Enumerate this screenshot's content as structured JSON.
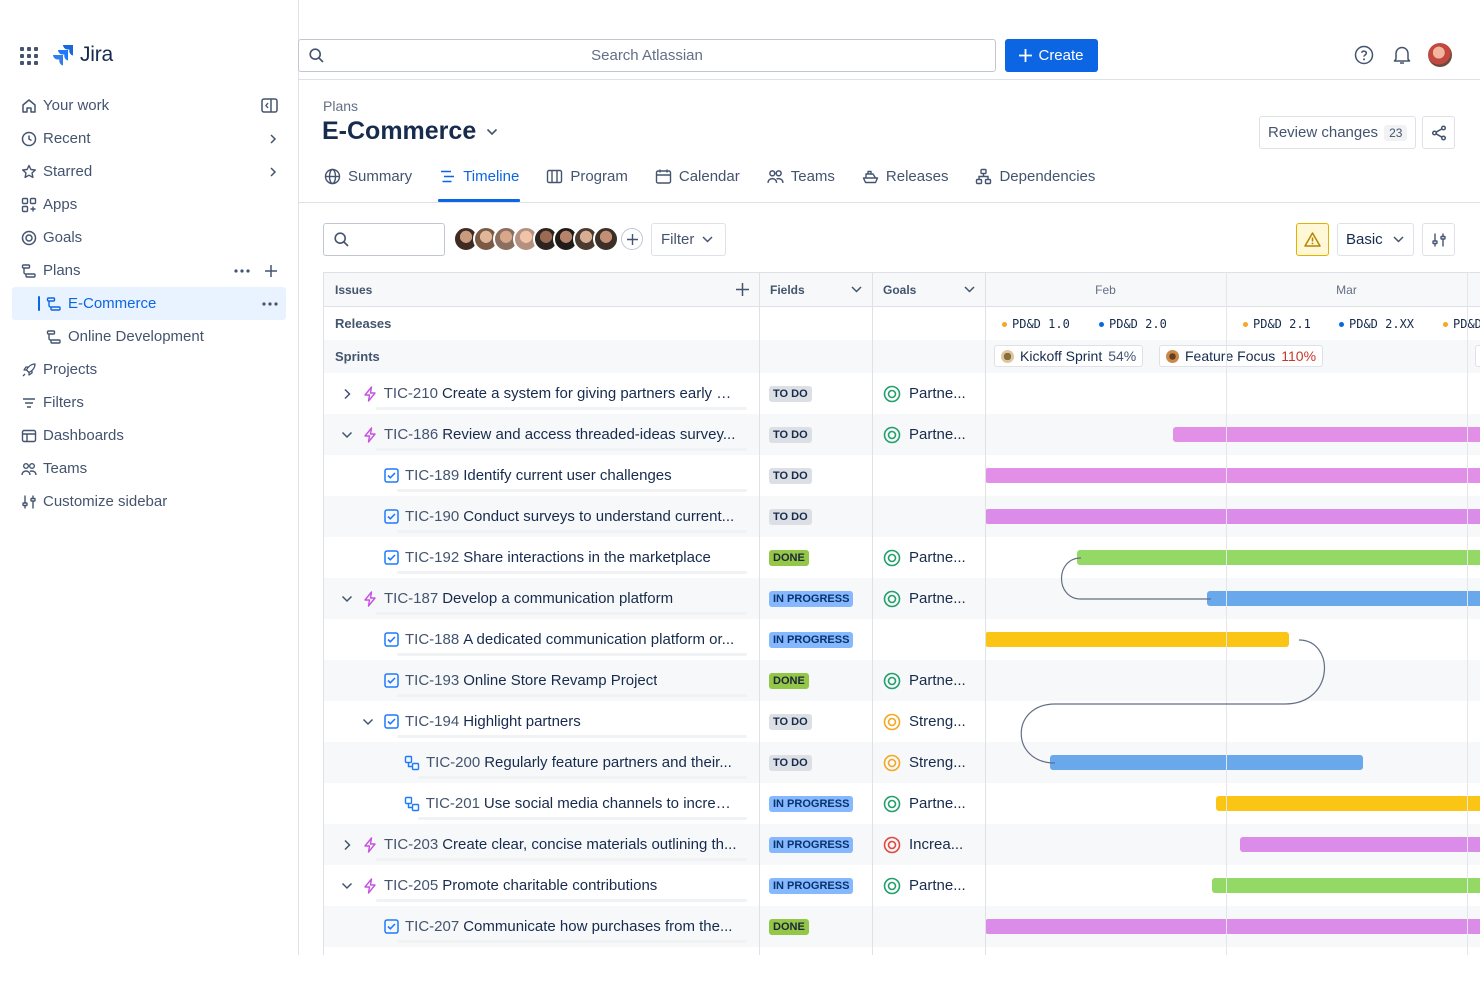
{
  "app": {
    "name": "Jira"
  },
  "sidebar": {
    "items": [
      {
        "label": "Your work",
        "icon": "home-icon"
      },
      {
        "label": "Recent",
        "icon": "clock-icon"
      },
      {
        "label": "Starred",
        "icon": "star-icon"
      },
      {
        "label": "Apps",
        "icon": "apps-icon"
      },
      {
        "label": "Goals",
        "icon": "goal-icon"
      },
      {
        "label": "Plans",
        "icon": "plan-icon"
      },
      {
        "label": "E-Commerce",
        "icon": "plan-icon"
      },
      {
        "label": "Online Development",
        "icon": "plan-icon"
      },
      {
        "label": "Projects",
        "icon": "rocket-icon"
      },
      {
        "label": "Filters",
        "icon": "filter-icon"
      },
      {
        "label": "Dashboards",
        "icon": "dashboard-icon"
      },
      {
        "label": "Teams",
        "icon": "people-icon"
      },
      {
        "label": "Customize sidebar",
        "icon": "customize-icon"
      }
    ]
  },
  "topbar": {
    "search_placeholder": "Search Atlassian",
    "create_label": "Create"
  },
  "page": {
    "breadcrumb": "Plans",
    "title": "E-Commerce",
    "review_label": "Review changes",
    "review_count": "23",
    "tabs": [
      {
        "label": "Summary",
        "icon": "globe-icon"
      },
      {
        "label": "Timeline",
        "icon": "timeline-icon",
        "active": true
      },
      {
        "label": "Program",
        "icon": "board-icon"
      },
      {
        "label": "Calendar",
        "icon": "calendar-icon"
      },
      {
        "label": "Teams",
        "icon": "people-icon"
      },
      {
        "label": "Releases",
        "icon": "ship-icon"
      },
      {
        "label": "Dependencies",
        "icon": "hierarchy-icon"
      }
    ]
  },
  "toolbar": {
    "filter_label": "Filter",
    "view_label": "Basic"
  },
  "table": {
    "headers": {
      "issues": "Issues",
      "fields": "Fields",
      "goals": "Goals"
    },
    "months": [
      "Feb",
      "Mar"
    ],
    "releases_label": "Releases",
    "sprints_label": "Sprints",
    "releases": [
      {
        "name": "PD&D 1.0",
        "color": "#f5a623"
      },
      {
        "name": "PD&D 2.0",
        "color": "#0c66e4"
      },
      {
        "name": "PD&D 2.1",
        "color": "#f5a623"
      },
      {
        "name": "PD&D 2.XX",
        "color": "#0c66e4"
      },
      {
        "name": "PD&D",
        "color": "#f5a623"
      }
    ],
    "sprints": [
      {
        "name": "Kickoff Sprint",
        "pct": "54%",
        "over": false
      },
      {
        "name": "Feature Focus",
        "pct": "110%",
        "over": true
      }
    ],
    "rows": [
      {
        "key": "TIC-210",
        "summary": "Create a system for giving partners early ac...",
        "level": 0,
        "type": "epic",
        "chevron": "right",
        "status": "TO DO",
        "goal": "Partne...",
        "goal_color": "#22a06b",
        "bar": null
      },
      {
        "key": "TIC-186",
        "summary": "Review and access threaded-ideas survey...",
        "level": 0,
        "type": "epic",
        "chevron": "down",
        "status": "TO DO",
        "goal": "Partne...",
        "goal_color": "#22a06b",
        "bar": {
          "start": 0.39,
          "end": 1.05,
          "color": "#e28fe8"
        }
      },
      {
        "key": "TIC-189",
        "summary": "Identify current user challenges",
        "level": 1,
        "type": "task",
        "chevron": "",
        "status": "TO DO",
        "goal": "",
        "goal_color": "",
        "bar": {
          "start": 0.0,
          "end": 1.05,
          "color": "#e28fe8"
        }
      },
      {
        "key": "TIC-190",
        "summary": "Conduct surveys to understand current...",
        "level": 1,
        "type": "task",
        "chevron": "",
        "status": "TO DO",
        "goal": "",
        "goal_color": "",
        "bar": {
          "start": 0.0,
          "end": 1.05,
          "color": "#da8ce8"
        }
      },
      {
        "key": "TIC-192",
        "summary": "Share interactions in the marketplace",
        "level": 1,
        "type": "task",
        "chevron": "",
        "status": "DONE",
        "goal": "Partne...",
        "goal_color": "#22a06b",
        "bar": {
          "start": 0.19,
          "end": 1.05,
          "color": "#94d865"
        }
      },
      {
        "key": "TIC-187",
        "summary": "Develop a communication platform",
        "level": 0,
        "type": "epic",
        "chevron": "down",
        "status": "IN PROGRESS",
        "goal": "Partne...",
        "goal_color": "#22a06b",
        "bar": {
          "start": 0.46,
          "end": 1.05,
          "color": "#6aa8ec"
        }
      },
      {
        "key": "TIC-188",
        "summary": "A dedicated communication platform or...",
        "level": 1,
        "type": "task",
        "chevron": "",
        "status": "IN PROGRESS",
        "goal": "",
        "goal_color": "",
        "bar": {
          "start": 0.0,
          "end": 0.63,
          "color": "#fac515"
        }
      },
      {
        "key": "TIC-193",
        "summary": "Online Store Revamp Project",
        "level": 1,
        "type": "task",
        "chevron": "",
        "status": "DONE",
        "goal": "Partne...",
        "goal_color": "#22a06b",
        "bar": null
      },
      {
        "key": "TIC-194",
        "summary": "Highlight partners",
        "level": 1,
        "type": "task",
        "chevron": "down",
        "status": "TO DO",
        "goal": "Streng...",
        "goal_color": "#f5a623",
        "bar": null
      },
      {
        "key": "TIC-200",
        "summary": "Regularly feature partners and their...",
        "level": 2,
        "type": "subtask",
        "chevron": "",
        "status": "TO DO",
        "goal": "Streng...",
        "goal_color": "#f5a623",
        "bar": {
          "start": 0.135,
          "end": 0.785,
          "color": "#6aa8ec"
        }
      },
      {
        "key": "TIC-201",
        "summary": "Use social media channels to increas...",
        "level": 2,
        "type": "subtask",
        "chevron": "",
        "status": "IN PROGRESS",
        "goal": "Partne...",
        "goal_color": "#22a06b",
        "bar": {
          "start": 0.48,
          "end": 1.05,
          "color": "#fac515"
        }
      },
      {
        "key": "TIC-203",
        "summary": "Create clear, concise materials outlining th...",
        "level": 0,
        "type": "epic",
        "chevron": "right",
        "status": "IN PROGRESS",
        "goal": "Increa...",
        "goal_color": "#e2483d",
        "bar": {
          "start": 0.53,
          "end": 1.05,
          "color": "#da8ce8"
        }
      },
      {
        "key": "TIC-205",
        "summary": "Promote charitable contributions",
        "level": 0,
        "type": "epic",
        "chevron": "down",
        "status": "IN PROGRESS",
        "goal": "Partne...",
        "goal_color": "#22a06b",
        "bar": {
          "start": 0.47,
          "end": 1.05,
          "color": "#94d865"
        }
      },
      {
        "key": "TIC-207",
        "summary": "Communicate how purchases from the...",
        "level": 1,
        "type": "task",
        "chevron": "",
        "status": "DONE",
        "goal": "",
        "goal_color": "",
        "bar": {
          "start": 0.0,
          "end": 1.05,
          "color": "#da8ce8"
        }
      }
    ]
  }
}
